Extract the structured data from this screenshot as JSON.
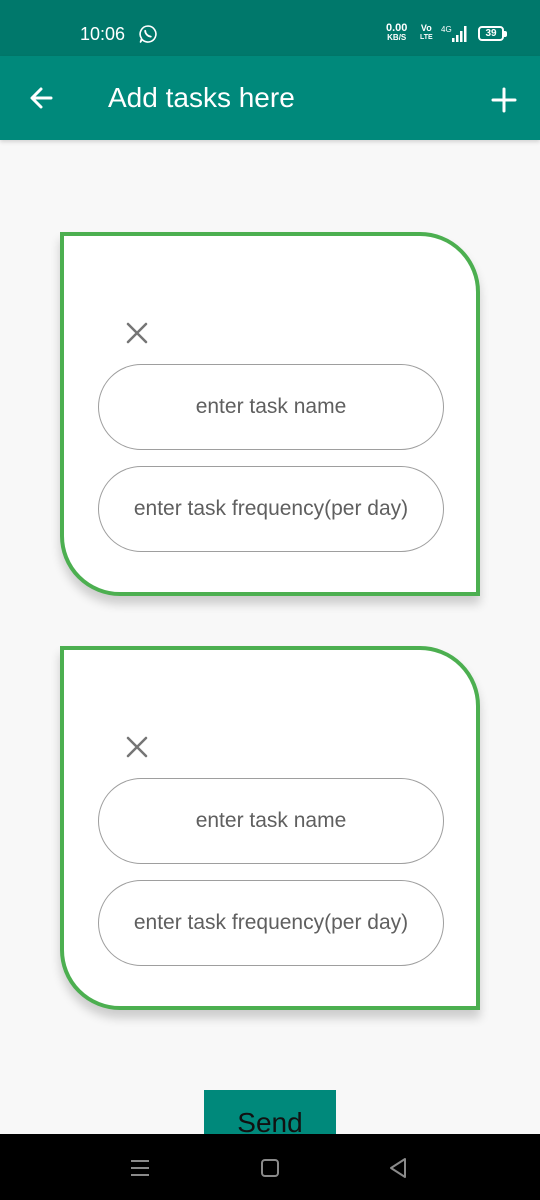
{
  "status_bar": {
    "time": "10:06",
    "net_speed_value": "0.00",
    "net_speed_unit": "KB/S",
    "volte_top": "Vo",
    "volte_bottom": "LTE",
    "network_type": "4G",
    "battery_level": "39",
    "icons": [
      "whatsapp-icon",
      "signal-icon",
      "battery-icon"
    ]
  },
  "app_bar": {
    "title": "Add tasks here",
    "back_icon": "arrow-left-icon",
    "add_icon": "plus-icon"
  },
  "tasks": [
    {
      "name_placeholder": "enter task name",
      "frequency_placeholder": "enter task frequency(per day)",
      "close_icon": "close-icon"
    },
    {
      "name_placeholder": "enter task name",
      "frequency_placeholder": "enter task frequency(per day)",
      "close_icon": "close-icon"
    }
  ],
  "send_label": "Send",
  "nav_bar": {
    "icons": [
      "menu-icon",
      "home-icon",
      "back-icon"
    ]
  },
  "colors": {
    "status_bar": "#00786b",
    "app_bar": "#00897b",
    "card_border": "#4caf50",
    "background": "#f8f8f8",
    "send_button": "#00897b"
  }
}
